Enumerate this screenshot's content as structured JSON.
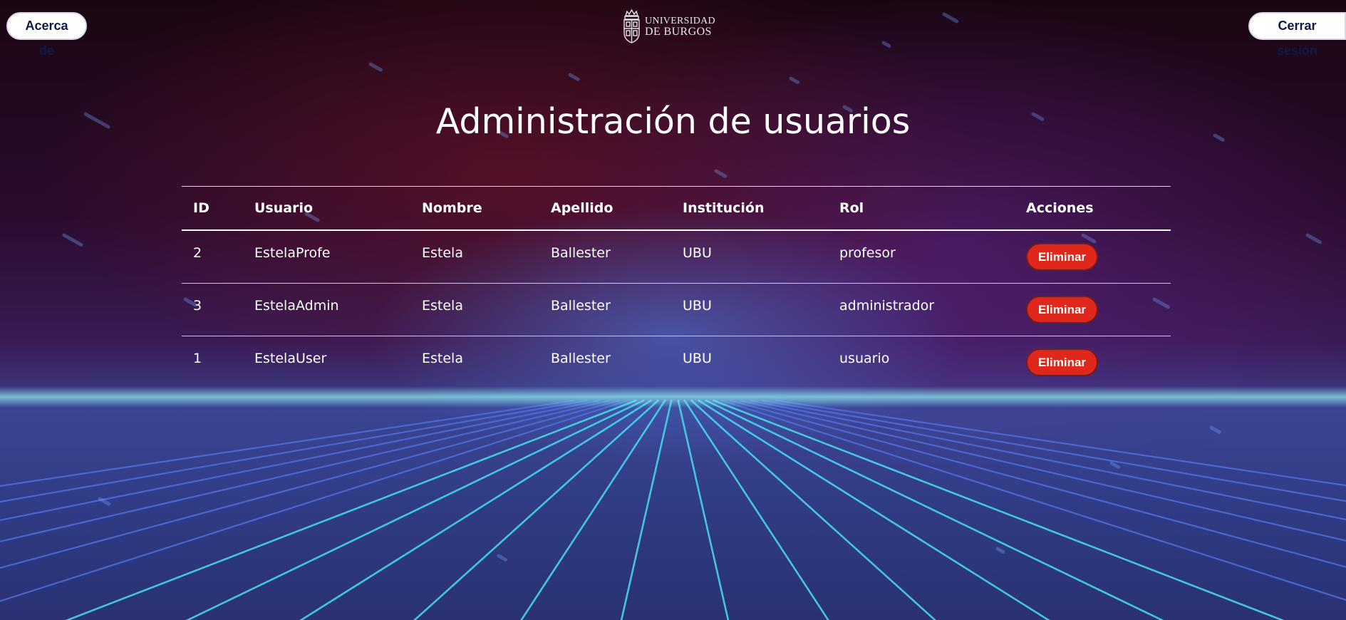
{
  "header": {
    "about_label": "Acerca de",
    "logout_label": "Cerrar sesión",
    "logo": {
      "line1": "UNIVERSIDAD",
      "line2": "DE BURGOS"
    }
  },
  "main": {
    "title": "Administración de usuarios",
    "table": {
      "headers": {
        "id": "ID",
        "user": "Usuario",
        "name": "Nombre",
        "last": "Apellido",
        "inst": "Institución",
        "rol": "Rol",
        "actions": "Acciones"
      },
      "rows": [
        {
          "id": "2",
          "user": "EstelaProfe",
          "name": "Estela",
          "last": "Ballester",
          "inst": "UBU",
          "rol": "profesor",
          "action": "Eliminar"
        },
        {
          "id": "3",
          "user": "EstelaAdmin",
          "name": "Estela",
          "last": "Ballester",
          "inst": "UBU",
          "rol": "administrador",
          "action": "Eliminar"
        },
        {
          "id": "1",
          "user": "EstelaUser",
          "name": "Estela",
          "last": "Ballester",
          "inst": "UBU",
          "rol": "usuario",
          "action": "Eliminar"
        }
      ]
    }
  },
  "colors": {
    "delete_button": "#e0271b",
    "grid_glow": "#3fd3e6",
    "text": "#ffffff"
  },
  "icons": {
    "logo": "university-crest-icon"
  }
}
